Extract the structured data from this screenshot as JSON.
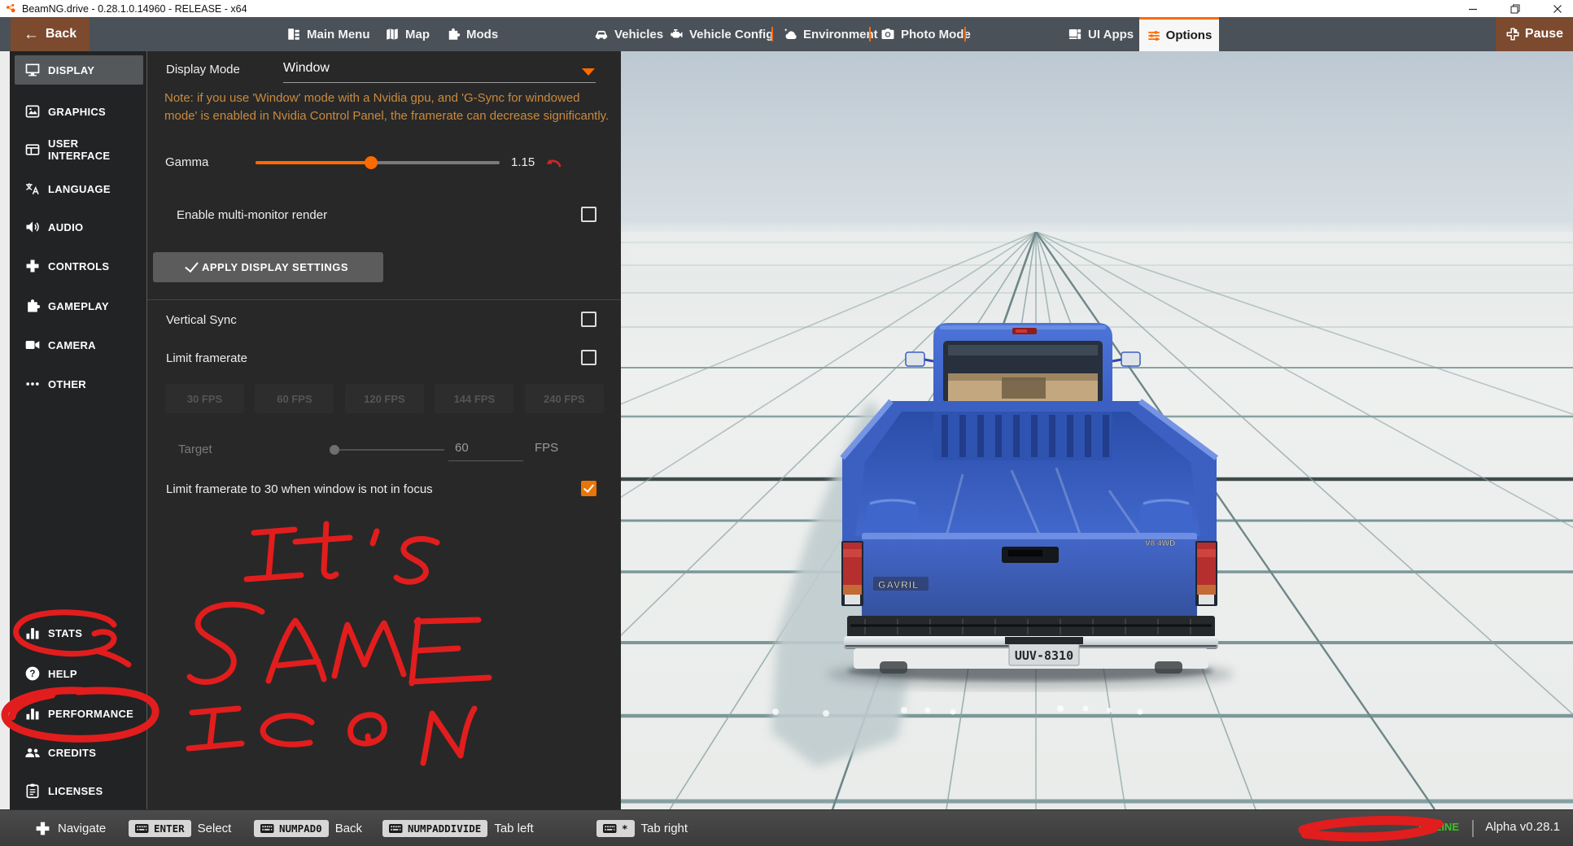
{
  "titlebar": {
    "title": "BeamNG.drive - 0.28.1.0.14960 - RELEASE - x64"
  },
  "navbar": {
    "back_label": "Back",
    "items": [
      {
        "label": "Main Menu"
      },
      {
        "label": "Map"
      },
      {
        "label": "Mods"
      },
      {
        "label": "Vehicles"
      },
      {
        "label": "Vehicle Config"
      },
      {
        "label": "Environment"
      },
      {
        "label": "Photo Mode"
      },
      {
        "label": "UI Apps"
      }
    ],
    "options_label": "Options",
    "pause_label": "Pause"
  },
  "sidebar": {
    "items": [
      {
        "label": "DISPLAY",
        "icon": "display-icon",
        "active": true
      },
      {
        "label": "GRAPHICS",
        "icon": "graphics-icon"
      },
      {
        "label": "USER INTERFACE",
        "icon": "user-interface-icon"
      },
      {
        "label": "LANGUAGE",
        "icon": "language-icon"
      },
      {
        "label": "AUDIO",
        "icon": "audio-icon"
      },
      {
        "label": "CONTROLS",
        "icon": "controls-icon"
      },
      {
        "label": "GAMEPLAY",
        "icon": "gameplay-icon"
      },
      {
        "label": "CAMERA",
        "icon": "camera-icon"
      },
      {
        "label": "OTHER",
        "icon": "other-icon"
      },
      {
        "label": "STATS",
        "icon": "bar-chart-icon"
      },
      {
        "label": "HELP",
        "icon": "help-icon"
      },
      {
        "label": "PERFORMANCE",
        "icon": "bar-chart-icon"
      },
      {
        "label": "CREDITS",
        "icon": "credits-icon"
      },
      {
        "label": "LICENSES",
        "icon": "licenses-icon"
      }
    ]
  },
  "panel": {
    "display_mode_label": "Display Mode",
    "display_mode_value": "Window",
    "note": "Note: if you use 'Window' mode with a Nvidia gpu, and 'G-Sync for windowed mode' is enabled in Nvidia Control Panel, the framerate can decrease significantly.",
    "gamma_label": "Gamma",
    "gamma_value": "1.15",
    "multi_monitor_label": "Enable multi-monitor render",
    "apply_button_label": "APPLY DISPLAY SETTINGS",
    "vsync_label": "Vertical Sync",
    "limit_framerate_label": "Limit framerate",
    "fps_buttons": [
      "30 FPS",
      "60 FPS",
      "120 FPS",
      "144 FPS",
      "240 FPS"
    ],
    "target_label": "Target",
    "target_value": "60",
    "target_unit": "FPS",
    "limit_focus_label": "Limit framerate to 30 when window is not in focus"
  },
  "scene": {
    "plate": "UUV-8310",
    "make_badge": "GAVRIL",
    "trim_badge": "V8  4WD"
  },
  "bottombar": {
    "navigate_label": "Navigate",
    "hints": [
      {
        "key": "ENTER",
        "label": "Select"
      },
      {
        "key": "NUMPAD0",
        "label": "Back"
      },
      {
        "key": "NUMPADDIVIDE",
        "label": "Tab left"
      },
      {
        "key": "*",
        "label": "Tab right"
      }
    ],
    "online_label": "ONLINE",
    "version_label": "Alpha v0.28.1"
  },
  "annotations": {
    "handwriting": "It's SAME ICON",
    "words": [
      "It's",
      "SAME",
      "ICON"
    ],
    "circled_items": [
      "STATS",
      "PERFORMANCE"
    ]
  },
  "colors": {
    "accent": "#ff6a00",
    "warning_text": "#c98a3e",
    "annotation_red": "#e21d1d",
    "online_green": "#3ec327",
    "checkbox_checked": "#e8750a",
    "truck_blue": "#3b60c2",
    "nav_bar": "#4a5158",
    "back_button_brown": "#7c4a2e"
  }
}
